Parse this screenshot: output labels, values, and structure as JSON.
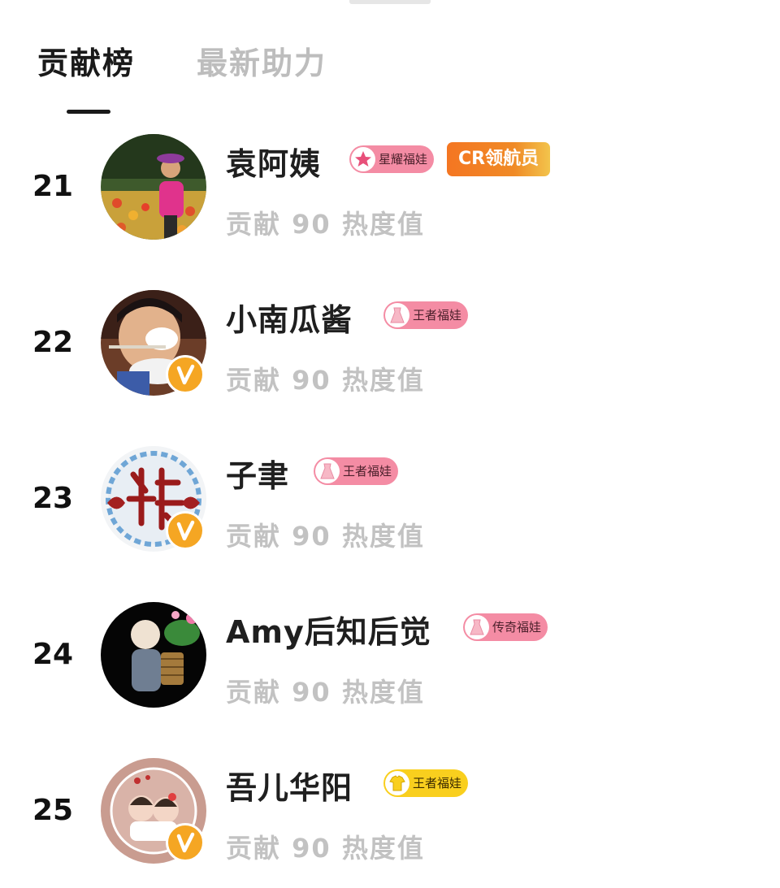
{
  "tabs": [
    {
      "label": "贡献榜",
      "active": true
    },
    {
      "label": "最新助力",
      "active": false
    }
  ],
  "colors": {
    "active_tab": "#1a1a1a",
    "inactive_tab": "#bdbdbd",
    "badge_pink": "#f48ca4",
    "badge_yellow": "#f9cf1e",
    "verified_badge": "#f5a623",
    "role_badge": "#f47622",
    "sub_text": "#c2c2c2"
  },
  "list": [
    {
      "rank": "21",
      "name": "袁阿姨",
      "badge": {
        "label": "星耀福娃",
        "icon": "star-icon",
        "style": "pink"
      },
      "role_badge": "CR领航员",
      "verified": false,
      "contribution": "贡献 90 热度值"
    },
    {
      "rank": "22",
      "name": "小南瓜酱",
      "badge": {
        "label": "王者福娃",
        "icon": "dress-icon",
        "style": "pink"
      },
      "verified": true,
      "contribution": "贡献 90 热度值"
    },
    {
      "rank": "23",
      "name": "子聿",
      "badge": {
        "label": "王者福娃",
        "icon": "dress-icon",
        "style": "pink"
      },
      "verified": true,
      "contribution": "贡献 90 热度值"
    },
    {
      "rank": "24",
      "name": "Amy后知后觉",
      "badge": {
        "label": "传奇福娃",
        "icon": "dress-icon",
        "style": "pink"
      },
      "verified": false,
      "contribution": "贡献 90 热度值"
    },
    {
      "rank": "25",
      "name": "吾儿华阳",
      "badge": {
        "label": "王者福娃",
        "icon": "shirt-icon",
        "style": "yellow"
      },
      "verified": true,
      "contribution": "贡献 90 热度值"
    }
  ]
}
